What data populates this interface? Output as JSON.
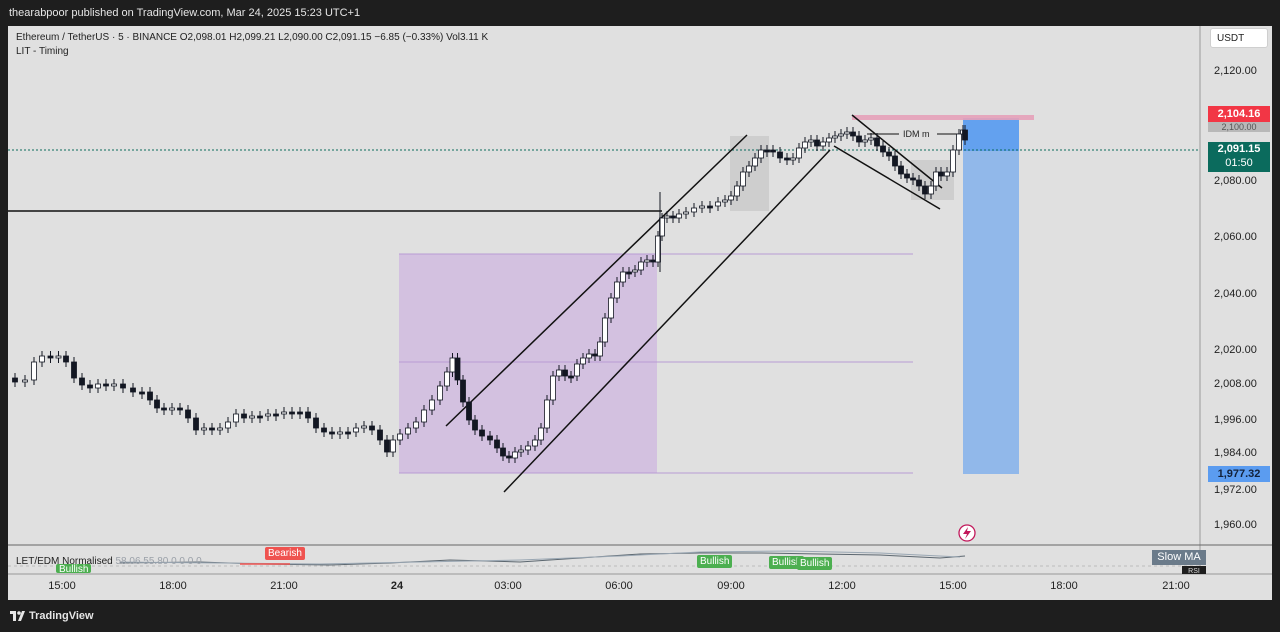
{
  "header": {
    "publish_line": "thearabpoor published on TradingView.com, Mar 24, 2025 15:23 UTC+1"
  },
  "legend": {
    "symbol_line": "Ethereum / TetherUS · 5 · BINANCE  O2,098.01  H2,099.21  L2,090.00  C2,091.15  −6.85 (−0.33%)  Vol3.11 K",
    "indicator_line": "LIT - Timing"
  },
  "currency_button": "USDT",
  "price_axis": {
    "ticks": [
      "2,120.00",
      "2,080.00",
      "2,060.00",
      "2,040.00",
      "2,020.00",
      "2,008.00",
      "1,996.00",
      "1,984.00",
      "1,972.00",
      "1,960.00"
    ],
    "labels": {
      "target_price": "2,104.16",
      "current_price": "2,091.15",
      "countdown": "01:50",
      "stop_price": "1,977.32",
      "hidden_label": "2,100.00"
    }
  },
  "time_axis": [
    "15:00",
    "18:00",
    "21:00",
    "24",
    "03:00",
    "06:00",
    "09:00",
    "12:00",
    "15:00",
    "18:00",
    "21:00"
  ],
  "annotations": {
    "idm_label": "IDM m"
  },
  "oscillator": {
    "name": "LET/EDM Normalised",
    "values": "58.06  55.80  0  0  0  0",
    "badges": {
      "bearish": "Bearish",
      "bullish": "Bullish"
    },
    "slow_ma": "Slow MA",
    "scale_cut": "RSI"
  },
  "footer": {
    "brand": "TradingView"
  },
  "colors": {
    "background": "#e0e0e0",
    "up": "#ffffff",
    "down": "#131722",
    "zone": "#c9a8e0",
    "target": "#f23645",
    "stop_zone": "#5b9cf0",
    "current": "#0b6b5d",
    "bullish": "#4caf50",
    "bearish": "#ef5350"
  }
}
